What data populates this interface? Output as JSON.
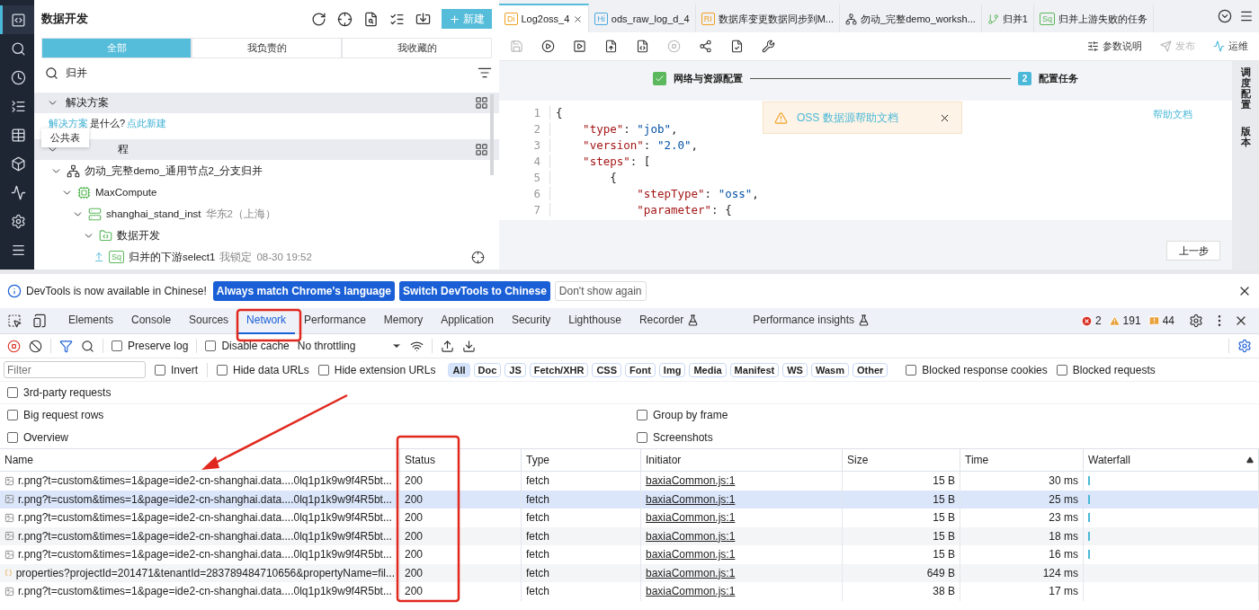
{
  "nav": [
    {
      "selected": true
    },
    {
      "selected": false
    },
    {
      "selected": false
    },
    {
      "selected": false
    },
    {
      "selected": false
    },
    {
      "selected": false
    },
    {
      "selected": false
    },
    {
      "selected": false
    },
    {
      "selected": false
    }
  ],
  "panel": {
    "title": "数据开发",
    "new_button": "新建",
    "tabs": [
      {
        "label": "全部",
        "selected": true
      },
      {
        "label": "我负责的",
        "selected": false
      },
      {
        "label": "我收藏的",
        "selected": false
      }
    ],
    "search": {
      "value": "归并"
    },
    "sections": [
      {
        "title": "解决方案",
        "expanded": true,
        "hint": {
          "link": "解决方案",
          "text": "是什么?",
          "action": "点此新建"
        }
      },
      {
        "title": "程",
        "expanded": true,
        "tree": [
          {
            "label": "勿动_完整demo_通用节点2_分支归并",
            "kind": "workflow",
            "expanded": true,
            "children": [
              {
                "label": "MaxCompute",
                "kind": "engine",
                "expanded": true,
                "children": [
                  {
                    "label": "shanghai_stand_inst",
                    "note": "华东2（上海）",
                    "kind": "instance",
                    "expanded": true,
                    "children": [
                      {
                        "label": "数据开发",
                        "kind": "folder",
                        "expanded": true,
                        "children": [
                          {
                            "label": "归并的下游select1",
                            "kind": "node",
                            "badge": "Sq",
                            "lock": "我锁定",
                            "time": "08-30 19:52"
                          }
                        ]
                      }
                    ]
                  }
                ]
              }
            ]
          }
        ]
      }
    ],
    "tooltip": "公共表"
  },
  "editor": {
    "tabs": [
      {
        "label": "Log2oss_4",
        "badge": "Di",
        "color": "#f0a020",
        "selected": true
      },
      {
        "label": "ods_raw_log_d_4",
        "badge": "Hi",
        "color": "#4aa8e0",
        "selected": false
      },
      {
        "label": "数据库变更数据同步到M...",
        "badge": "RI",
        "color": "#f0a020",
        "selected": false
      },
      {
        "label": "勿动_完整demo_worksh...",
        "kind": "workflow",
        "selected": false
      },
      {
        "label": "归并1",
        "kind": "branch",
        "selected": false
      },
      {
        "label": "归并上游失败的任务",
        "badge": "Sq",
        "color": "#5cb85c",
        "selected": false
      }
    ],
    "actions": [
      {
        "label": "参数说明",
        "disabled": false
      },
      {
        "label": "发布",
        "disabled": true
      },
      {
        "label": "运维",
        "disabled": false
      }
    ],
    "steps": [
      {
        "label": "网络与资源配置",
        "done": true
      },
      {
        "number": "2",
        "label": "配置任务",
        "done": false
      }
    ],
    "code": [
      {
        "n": "1",
        "text": "{"
      },
      {
        "n": "2",
        "text": "    \"type\": \"job\","
      },
      {
        "n": "3",
        "text": "    \"version\": \"2.0\","
      },
      {
        "n": "4",
        "text": "    \"steps\": ["
      },
      {
        "n": "5",
        "text": "        {"
      },
      {
        "n": "6",
        "text": "            \"stepType\": \"oss\","
      },
      {
        "n": "7",
        "text": "            \"parameter\": {"
      }
    ],
    "alert": "OSS 数据源帮助文档",
    "help_link": "帮助文档",
    "prev_button": "上一步",
    "rail": [
      "调度配置",
      "版本"
    ]
  },
  "devtools": {
    "banner": {
      "text": "DevTools is now available in Chinese!",
      "buttons": [
        "Always match Chrome's language",
        "Switch DevTools to Chinese"
      ],
      "dismiss": "Don't show again"
    },
    "tabs": [
      {
        "label": "Elements",
        "selected": false
      },
      {
        "label": "Console",
        "selected": false
      },
      {
        "label": "Sources",
        "selected": false
      },
      {
        "label": "Network",
        "selected": true
      },
      {
        "label": "Performance",
        "selected": false
      },
      {
        "label": "Memory",
        "selected": false
      },
      {
        "label": "Application",
        "selected": false
      },
      {
        "label": "Security",
        "selected": false
      },
      {
        "label": "Lighthouse",
        "selected": false
      },
      {
        "label": "Recorder",
        "selected": false,
        "experimental": true
      },
      {
        "label": "Performance insights",
        "selected": false,
        "experimental": true
      }
    ],
    "counts": {
      "errors": "2",
      "warnings": "191",
      "issues": "44"
    },
    "toolbar": {
      "preserve_log": {
        "label": "Preserve log",
        "checked": false
      },
      "disable_cache": {
        "label": "Disable cache",
        "checked": false
      },
      "throttling": "No throttling"
    },
    "filter": {
      "placeholder": "Filter",
      "invert": {
        "label": "Invert",
        "checked": false
      },
      "hide_data": {
        "label": "Hide data URLs",
        "checked": false
      },
      "hide_ext": {
        "label": "Hide extension URLs",
        "checked": false
      },
      "types": [
        {
          "label": "All",
          "selected": true
        },
        {
          "label": "Doc",
          "selected": false
        },
        {
          "label": "JS",
          "selected": false
        },
        {
          "label": "Fetch/XHR",
          "selected": false
        },
        {
          "label": "CSS",
          "selected": false
        },
        {
          "label": "Font",
          "selected": false
        },
        {
          "label": "Img",
          "selected": false
        },
        {
          "label": "Media",
          "selected": false
        },
        {
          "label": "Manifest",
          "selected": false
        },
        {
          "label": "WS",
          "selected": false
        },
        {
          "label": "Wasm",
          "selected": false
        },
        {
          "label": "Other",
          "selected": false
        }
      ],
      "blocked_cookies": {
        "label": "Blocked response cookies",
        "checked": false
      },
      "blocked_requests": {
        "label": "Blocked requests",
        "checked": false
      }
    },
    "options": [
      {
        "label": "3rd-party requests",
        "checked": false
      },
      {
        "label": "Big request rows",
        "checked": false
      },
      {
        "label": "Group by frame",
        "checked": false
      },
      {
        "label": "Overview",
        "checked": false
      },
      {
        "label": "Screenshots",
        "checked": false
      }
    ],
    "table": {
      "columns": [
        "Name",
        "Status",
        "Type",
        "Initiator",
        "Size",
        "Time",
        "Waterfall"
      ],
      "rows": [
        {
          "kind": "image",
          "name": "r.png?t=custom&times=1&page=ide2-cn-shanghai.data....0lq1p1k9w9f4R5bt...",
          "status": "200",
          "type": "fetch",
          "initiator": "baxiaCommon.js:1",
          "size": "15 B",
          "time": "30 ms",
          "selected": false
        },
        {
          "kind": "image",
          "name": "r.png?t=custom&times=1&page=ide2-cn-shanghai.data....0lq1p1k9w9f4R5bt...",
          "status": "200",
          "type": "fetch",
          "initiator": "baxiaCommon.js:1",
          "size": "15 B",
          "time": "25 ms",
          "selected": true
        },
        {
          "kind": "image",
          "name": "r.png?t=custom&times=1&page=ide2-cn-shanghai.data....0lq1p1k9w9f4R5bt...",
          "status": "200",
          "type": "fetch",
          "initiator": "baxiaCommon.js:1",
          "size": "15 B",
          "time": "23 ms",
          "selected": false
        },
        {
          "kind": "image",
          "name": "r.png?t=custom&times=1&page=ide2-cn-shanghai.data....0lq1p1k9w9f4R5bt...",
          "status": "200",
          "type": "fetch",
          "initiator": "baxiaCommon.js:1",
          "size": "15 B",
          "time": "18 ms",
          "selected": false
        },
        {
          "kind": "image",
          "name": "r.png?t=custom&times=1&page=ide2-cn-shanghai.data....0lq1p1k9w9f4R5bt...",
          "status": "200",
          "type": "fetch",
          "initiator": "baxiaCommon.js:1",
          "size": "15 B",
          "time": "16 ms",
          "selected": false
        },
        {
          "kind": "json",
          "name": "properties?projectId=201471&tenantId=283789484710656&propertyName=fil...",
          "status": "200",
          "type": "fetch",
          "initiator": "baxiaCommon.js:1",
          "size": "649 B",
          "time": "124 ms",
          "selected": false
        },
        {
          "kind": "image",
          "name": "r.png?t=custom&times=1&page=ide2-cn-shanghai.data....0lq1p1k9w9f4R5bt...",
          "status": "200",
          "type": "fetch",
          "initiator": "baxiaCommon.js:1",
          "size": "38 B",
          "time": "17 ms",
          "selected": false
        }
      ]
    }
  }
}
